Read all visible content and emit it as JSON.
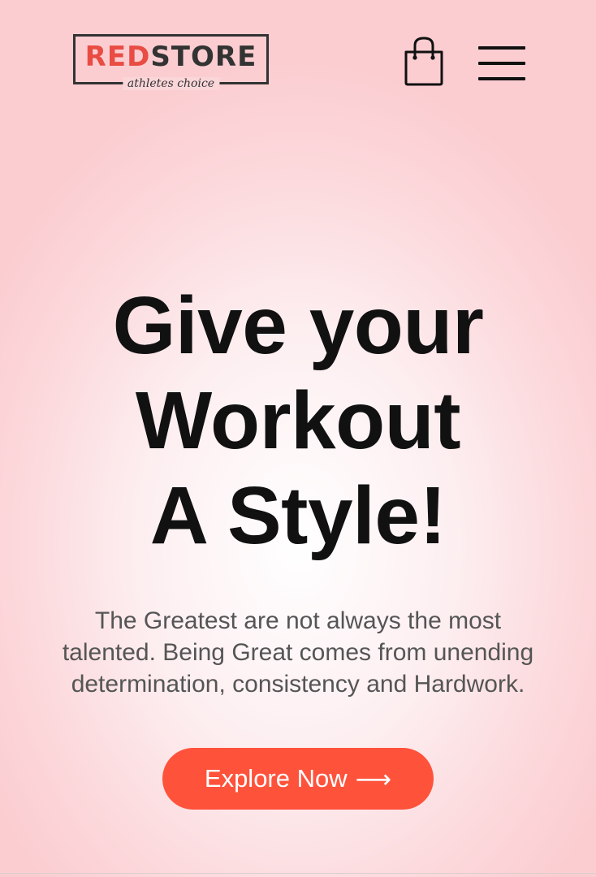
{
  "header": {
    "logo": {
      "brand_red": "RED",
      "brand_dark": "STORE",
      "tagline": "athletes choice"
    },
    "cart_icon": "shopping-bag-icon",
    "menu_icon": "hamburger-menu-icon"
  },
  "hero": {
    "headline_lines": [
      "Give your",
      "Workout",
      "A Style!"
    ],
    "subtext_lines": [
      "The Greatest are not always the most",
      "talented. Being Great comes from unending",
      "determination, consistency and Hardwork."
    ],
    "cta": {
      "label": "Explore Now",
      "arrow": "⟶"
    }
  },
  "colors": {
    "accent": "#ff523b",
    "logo_red": "#e84c43",
    "text_dark": "#111111",
    "text_muted": "#555555",
    "background_tint": "#fbcdd1"
  }
}
